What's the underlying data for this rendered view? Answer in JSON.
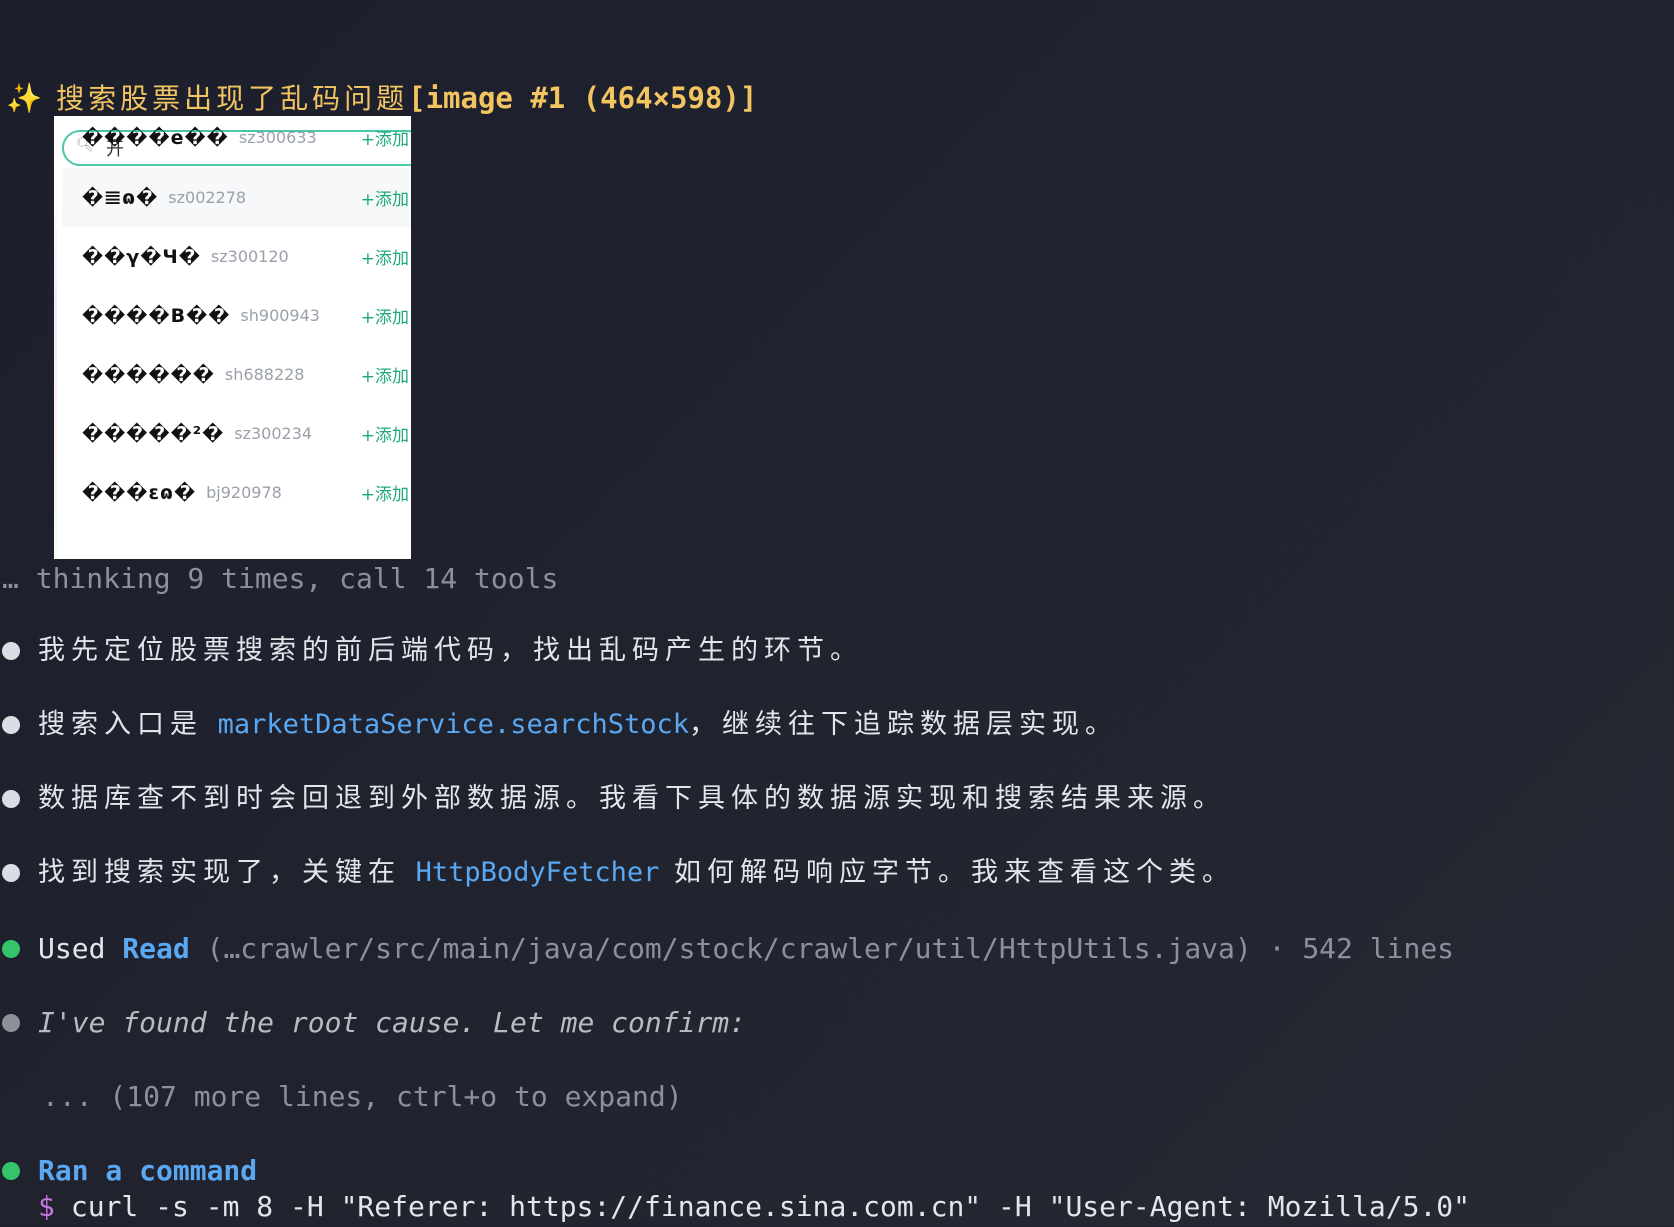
{
  "prompt": {
    "sparkle": "✨",
    "text": "搜索股票出现了乱码问题",
    "image_ref": "[image #1 (464×598)]"
  },
  "attachment": {
    "search_value": "开",
    "add_label": "+添加",
    "rows": [
      {
        "name": "����e��",
        "code": "sz300633"
      },
      {
        "name": "�𝌆ɷ�",
        "code": "sz002278"
      },
      {
        "name": "��γ�Ч�",
        "code": "sz300120"
      },
      {
        "name": "����B��",
        "code": "sh900943"
      },
      {
        "name": "������",
        "code": "sh688228"
      },
      {
        "name": "�����²�",
        "code": "sz300234"
      },
      {
        "name": "���ɛɷ�",
        "code": "bj920978"
      }
    ]
  },
  "thinking": "… thinking 9 times, call 14 tools",
  "messages": [
    {
      "pre": "我先定位股票搜索的前后端代码，找出乱码产生的环节。"
    },
    {
      "pre": "搜索入口是 ",
      "code": "marketDataService.searchStock",
      "post": "，继续往下追踪数据层实现。"
    },
    {
      "pre": "数据库查不到时会回退到外部数据源。我看下具体的数据源实现和搜索结果来源。"
    },
    {
      "pre": "找到搜索实现了，关键在 ",
      "code": "HttpBodyFetcher",
      "post": " 如何解码响应字节。我来查看这个类。"
    }
  ],
  "tool_read": {
    "used": "Used",
    "tool": "Read",
    "path": "(…crawler/src/main/java/com/stock/crawler/util/HttpUtils.java) · 542 lines"
  },
  "reasoning": {
    "text": "I've found the root cause. Let me confirm:",
    "more": "... (107 more lines, ctrl+o to expand)"
  },
  "command": {
    "title": "Ran a command",
    "prompt": "$",
    "text": "curl -s -m 8 -H \"Referer: https://finance.sina.com.cn\" -H \"User-Agent: Mozilla/5.0\""
  }
}
